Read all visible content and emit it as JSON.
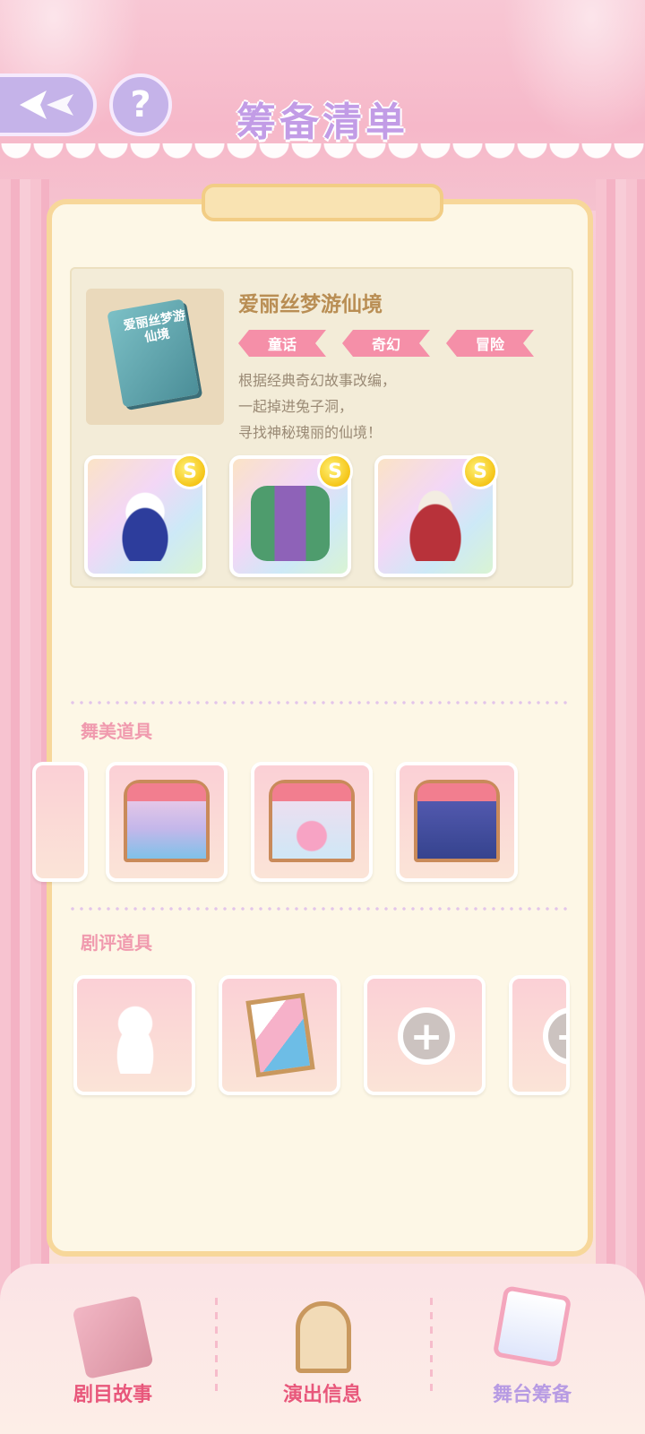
{
  "header": {
    "title": "筹备清单"
  },
  "story": {
    "name": "爱丽丝梦游仙境",
    "book_title": "爱丽丝梦游仙境",
    "tags": [
      "童话",
      "奇幻",
      "冒险"
    ],
    "description": [
      "根据经典奇幻故事改编，",
      "一起掉进兔子洞，",
      "寻找神秘瑰丽的仙境！"
    ],
    "costumes": [
      {
        "name": "blue-apron-dress",
        "badge": "S"
      },
      {
        "name": "green-jacket-suit",
        "badge": "S"
      },
      {
        "name": "red-top-hat",
        "badge": "S"
      }
    ]
  },
  "sections": {
    "stage_props_label": "舞美道具",
    "review_props_label": "剧评道具"
  },
  "bottom_nav": [
    {
      "label": "剧目故事",
      "color": "#e8577b"
    },
    {
      "label": "演出信息",
      "color": "#e8577b"
    },
    {
      "label": "舞台筹备",
      "color": "#b79be3"
    }
  ],
  "colors": {
    "accent": "#c29ce6",
    "tag": "#f58fa8",
    "board_border": "#f7d79a"
  }
}
